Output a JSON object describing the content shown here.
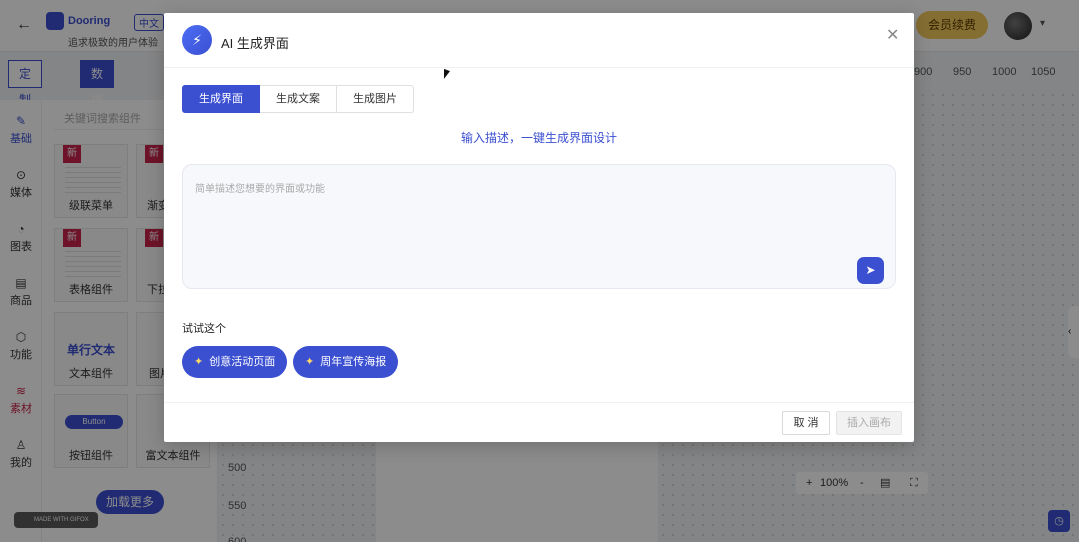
{
  "editor": {
    "brand": "Dooring",
    "lang": "中文",
    "slogan": "追求极致的用户体验",
    "vip": "会员续费",
    "tool_custom_panel": "定制面板",
    "tool_data_source": "数据源",
    "ruler_top": [
      "900",
      "950",
      "1000",
      "1050"
    ],
    "ruler_left": [
      "500",
      "550",
      "600"
    ],
    "search_placeholder": "关键词搜索组件",
    "sidebar": [
      "基础",
      "媒体",
      "图表",
      "商品",
      "功能",
      "素材",
      "我的"
    ],
    "new_tag": "新",
    "components": [
      "级联菜单",
      "渐变",
      "表格组件",
      "下拉",
      "文本组件",
      "图片",
      "按钮组件",
      "富文本组件"
    ],
    "text_thumb": "单行文本",
    "button_thumb": "Button",
    "load_more": "加载更多",
    "zoom": "100%",
    "zoom_minus": "-",
    "zoom_plus": "+",
    "gifox": "MADE WITH GIFOX"
  },
  "modal": {
    "title": "AI 生成界面",
    "tabs": [
      "生成界面",
      "生成文案",
      "生成图片"
    ],
    "subtitle": "输入描述，一键生成界面设计",
    "prompt_placeholder": "简单描述您想要的界面或功能",
    "try_label": "试试这个",
    "chips": [
      "创意活动页面",
      "周年宣传海报"
    ],
    "cancel": "取 消",
    "insert": "插入画布"
  },
  "colors": {
    "accent": "#3b4fd1",
    "new_tag": "#c8234c",
    "vip": "#f3c95b"
  }
}
